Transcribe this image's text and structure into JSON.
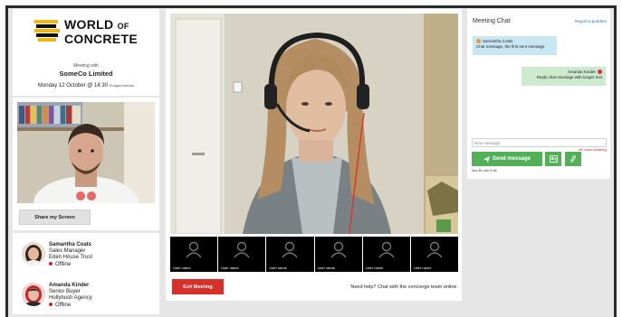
{
  "event": {
    "logo_line1": "WORLD",
    "logo_of": "OF",
    "logo_line2": "CONCRETE",
    "meeting_with": "Meeting with",
    "company": "SomeCo Limited",
    "datetime": "Monday 12 October @ 14:30",
    "timezone": "Europe/London"
  },
  "self_view": {
    "share_label": "Share my Screen"
  },
  "participants": [
    {
      "name": "Samantha Coats",
      "role": "Sales Manager",
      "org": "Eden House Trust",
      "status": "Offline"
    },
    {
      "name": "Amanda Kinder",
      "role": "Senior Buyer",
      "org": "Hollybush Agency",
      "status": "Offline"
    }
  ],
  "thumbnails": [
    {
      "label": "User name"
    },
    {
      "label": "User name"
    },
    {
      "label": "User name"
    },
    {
      "label": "User name"
    },
    {
      "label": "User name"
    },
    {
      "label": "User name"
    }
  ],
  "controls": {
    "exit_label": "Exit Meeting",
    "help_text": "Need help? Chat with the concierge team online."
  },
  "chat": {
    "title": "Meeting Chat",
    "report_link": "Report a problem",
    "messages": [
      {
        "sender": "Samantha Coats",
        "text": "Chat message, the first sent message",
        "direction": "in"
      },
      {
        "sender": "Amanda Kinder",
        "text": "Reply chat message with longer text",
        "direction": "out"
      }
    ],
    "input_placeholder": "New message",
    "chars_remaining": "160 chars remaining",
    "send_label": "Send message",
    "max_file_size": "Max file size 5 Mb"
  },
  "colors": {
    "accent_green": "#53b058",
    "exit_red": "#d4312b",
    "status_offline": "#c9262c",
    "link_blue": "#2e6bb3",
    "logo_gold": "#f0b51a"
  },
  "icons": [
    "send-icon",
    "card-icon",
    "paperclip-icon",
    "user-placeholder-icon",
    "status-dot-icon"
  ]
}
